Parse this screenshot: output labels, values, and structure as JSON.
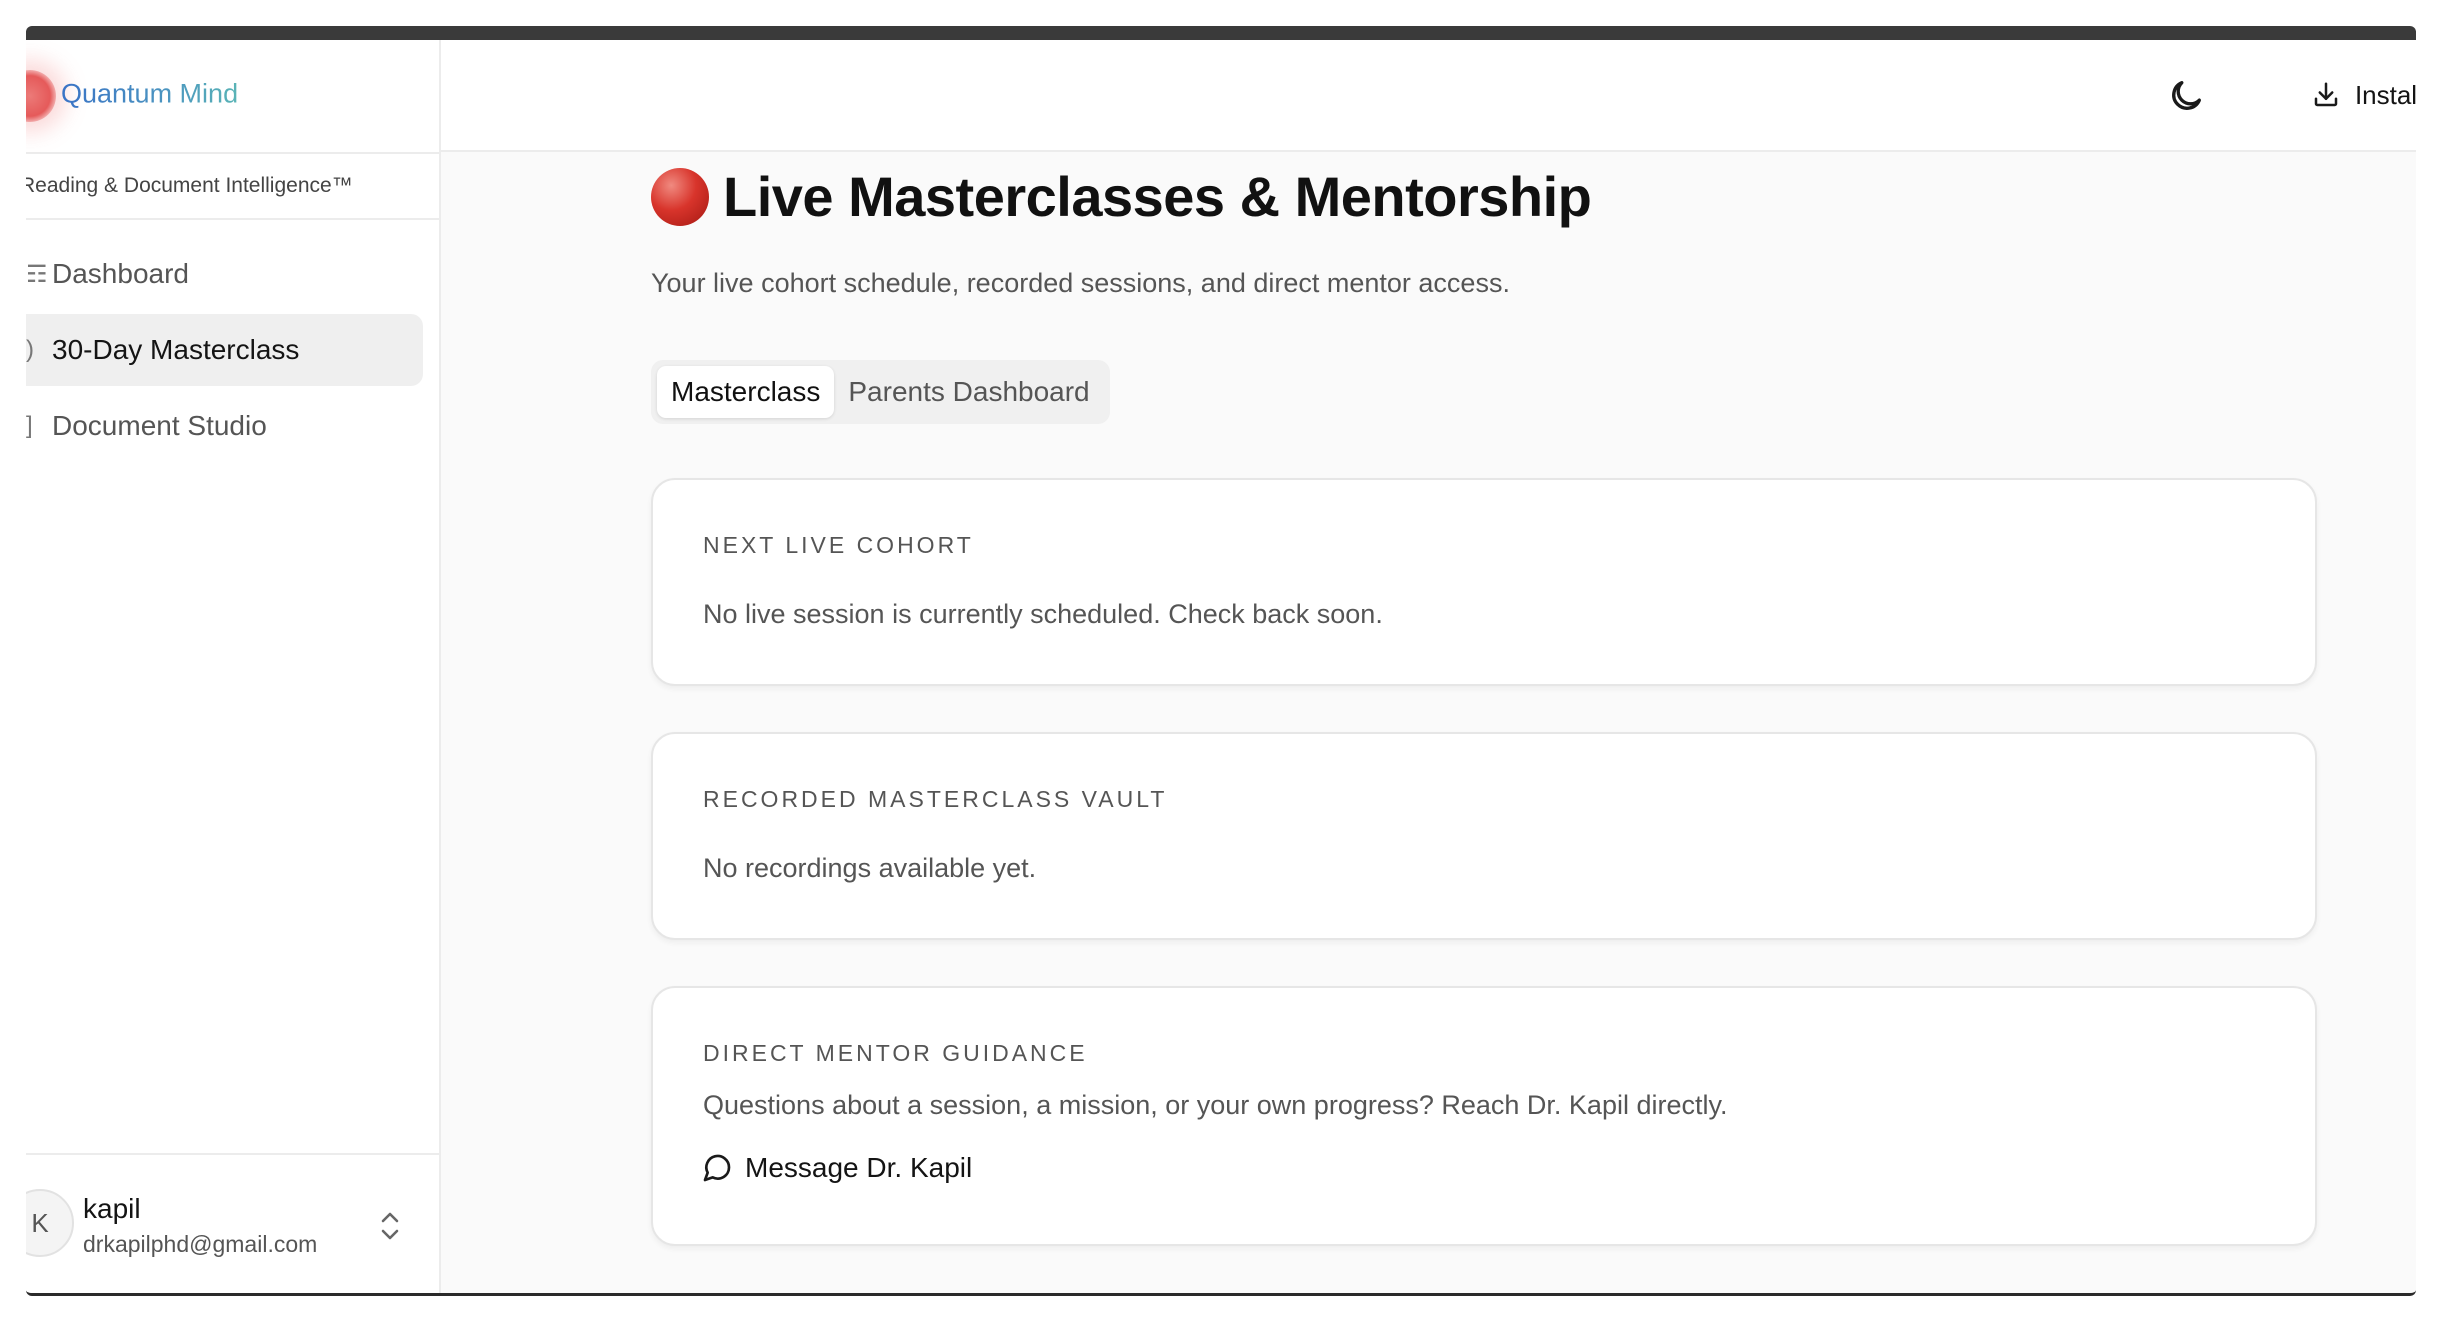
{
  "sidebar": {
    "brand_name": "Quantum Mind",
    "tagline": "Reading & Document Intelligence™",
    "items": [
      {
        "label": "Dashboard",
        "icon": "grid-icon",
        "active": false
      },
      {
        "label": "30-Day Masterclass",
        "icon": "play-circle-icon",
        "active": true
      },
      {
        "label": "Document Studio",
        "icon": "file-icon",
        "active": false
      }
    ],
    "user": {
      "initial": "K",
      "name": "kapil",
      "email": "drkapilphd@gmail.com"
    }
  },
  "topbar": {
    "install_label": "Install A"
  },
  "main": {
    "title": "Live Masterclasses & Mentorship",
    "subtitle": "Your live cohort schedule, recorded sessions, and direct mentor access.",
    "tabs": [
      {
        "label": "Masterclass",
        "active": true
      },
      {
        "label": "Parents Dashboard",
        "active": false
      }
    ],
    "cards": [
      {
        "label": "NEXT LIVE COHORT",
        "text": "No live session is currently scheduled. Check back soon."
      },
      {
        "label": "RECORDED MASTERCLASS VAULT",
        "text": "No recordings available yet."
      },
      {
        "label": "DIRECT MENTOR GUIDANCE",
        "text": "Questions about a session, a mission, or your own progress? Reach Dr. Kapil directly.",
        "link": "Message Dr. Kapil"
      }
    ]
  },
  "colors": {
    "accent_red": "#d8342b",
    "brand_blue": "#3a73c6",
    "brand_teal": "#5ab4b6"
  }
}
